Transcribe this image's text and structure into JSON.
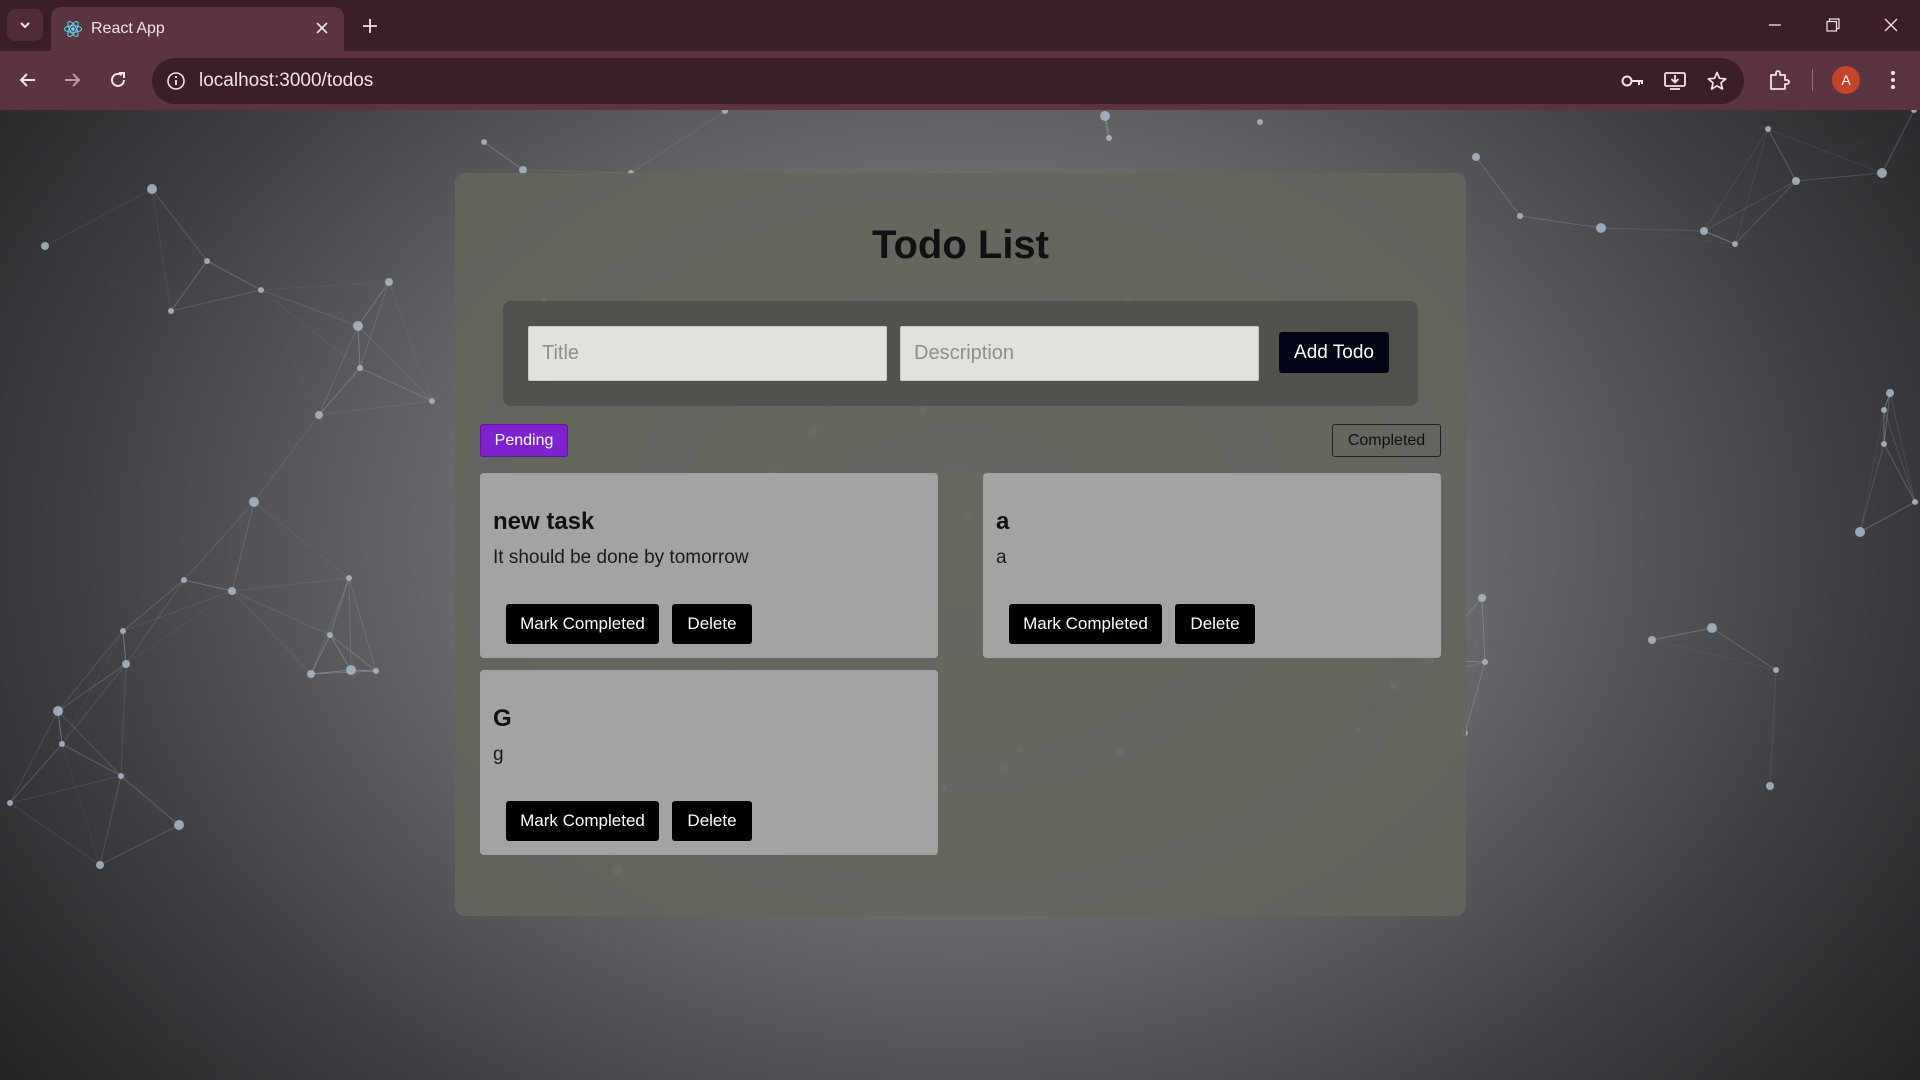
{
  "browser": {
    "tab_title": "React App",
    "url": "localhost:3000/todos",
    "profile_initial": "A"
  },
  "icons": {
    "tab_dropdown": "chevron-down-icon",
    "favicon": "react-icon",
    "tab_close": "close-icon",
    "new_tab": "plus-icon",
    "minimize": "minimize-icon",
    "restore": "restore-icon",
    "close_window": "close-icon",
    "back": "back-arrow-icon",
    "forward": "forward-arrow-icon",
    "reload": "reload-icon",
    "site_info": "info-icon",
    "password": "key-icon",
    "install": "install-icon",
    "bookmark": "star-icon",
    "extensions": "puzzle-icon",
    "menu": "kebab-menu-icon"
  },
  "app": {
    "title": "Todo List",
    "form": {
      "title_placeholder": "Title",
      "description_placeholder": "Description",
      "title_value": "",
      "description_value": "",
      "add_label": "Add Todo"
    },
    "filters": {
      "pending_label": "Pending",
      "completed_label": "Completed",
      "active": "Pending"
    },
    "todos": [
      {
        "title": "new task",
        "description": "It should be done by tomorrow",
        "mark_label": "Mark Completed",
        "delete_label": "Delete"
      },
      {
        "title": "a",
        "description": "a",
        "mark_label": "Mark Completed",
        "delete_label": "Delete"
      },
      {
        "title": "G",
        "description": "g",
        "mark_label": "Mark Completed",
        "delete_label": "Delete"
      }
    ]
  },
  "colors": {
    "tabbar": "#3b1f28",
    "toolbar": "#5a3540",
    "pending_active": "#7e22ce",
    "button_dark": "#000000",
    "particle": "#a9b8c9"
  }
}
